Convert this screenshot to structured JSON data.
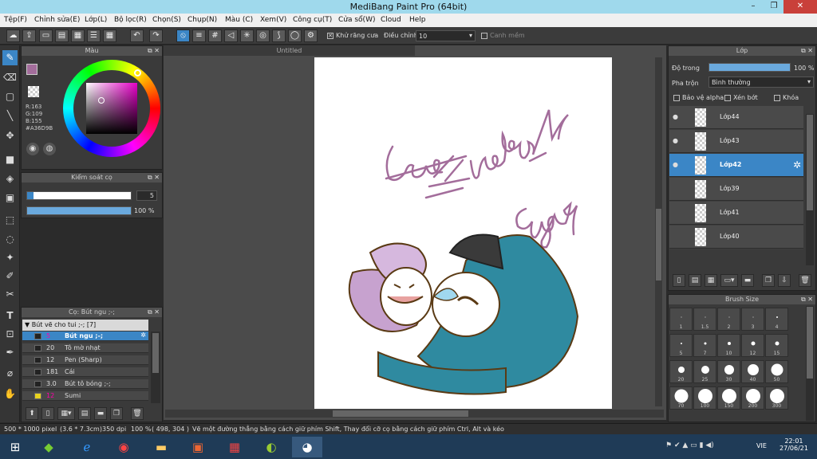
{
  "window": {
    "title": "MediBang Paint Pro (64bit)",
    "minimize": "–",
    "restore": "❐",
    "close": "✕"
  },
  "menu": [
    "Tệp(F)",
    "Chỉnh sửa(E)",
    "Lớp(L)",
    "Bộ lọc(R)",
    "Chọn(S)",
    "Chụp(N)",
    "Màu (C)",
    "Xem(V)",
    "Công cụ(T)",
    "Cửa sổ(W)",
    "Cloud",
    "Help"
  ],
  "toolbar": {
    "antialias_label": "Khử răng cưa",
    "correction_label": "Điều chỉnh",
    "correction_value": "10",
    "soft_label": "Canh mềm"
  },
  "color_panel": {
    "title": "Màu",
    "r": "R:163",
    "g": "G:109",
    "b": "B:155",
    "hex": "#A36D9B",
    "main_color": "#A36D9B"
  },
  "brush_control": {
    "title": "Kiểm soát cọ",
    "size_value": "5",
    "opacity_value": "100 %"
  },
  "brush_list": {
    "title": "Cọ: Bút ngu ;-;",
    "group": "Bút vẽ cho tui ;-; [7]",
    "items": [
      {
        "size": "5",
        "name": "Bút ngu ;-;",
        "swatch": "#222222"
      },
      {
        "size": "20",
        "name": "Tô mờ nhạt",
        "swatch": "#222222"
      },
      {
        "size": "12",
        "name": "Pen (Sharp)",
        "swatch": "#222222"
      },
      {
        "size": "181",
        "name": "Cái",
        "swatch": "#222222"
      },
      {
        "size": "3.0",
        "name": "Bút tô bóng ;-;",
        "swatch": "#222222"
      },
      {
        "size": "12",
        "name": "Sumi",
        "swatch": "#e8d21f"
      }
    ]
  },
  "document": {
    "tab": "Untitled"
  },
  "layers": {
    "title": "Lớp",
    "opacity_label": "Độ trong",
    "opacity_value": "100 %",
    "blend_label": "Pha trộn",
    "blend_value": "Bình thường",
    "protect_alpha": "Bảo vệ alpha",
    "clipping": "Xén bớt",
    "lock": "Khóa",
    "items": [
      {
        "name": "Lớp44"
      },
      {
        "name": "Lớp43"
      },
      {
        "name": "Lớp42"
      },
      {
        "name": "Lớp39"
      },
      {
        "name": "Lớp41"
      },
      {
        "name": "Lớp40"
      }
    ]
  },
  "brush_size": {
    "title": "Brush Size",
    "sizes": [
      "1",
      "1.5",
      "2",
      "3",
      "4",
      "5",
      "7",
      "10",
      "12",
      "15",
      "20",
      "25",
      "30",
      "40",
      "50",
      "70",
      "100",
      "150",
      "200",
      "300"
    ],
    "levels": [
      0.5,
      0.6,
      0.7,
      0.8,
      0.9,
      1.2,
      1.6,
      2.2,
      2.6,
      3.0,
      4.5,
      5.5,
      6.5,
      7.5,
      8.5,
      9.5,
      10,
      10,
      10,
      10
    ]
  },
  "status": {
    "size": "500 * 1000 pixel",
    "cm": "(3.6 * 7.3cm)",
    "dpi": "350 dpi",
    "zoom": "100 %",
    "coords": "( 498, 304 )",
    "hint": "Vẽ một đường thẳng bằng cách giữ phím Shift, Thay đổi cỡ cọ bằng cách giữ phím Ctrl, Alt và kéo"
  },
  "taskbar": {
    "lang": "VIE",
    "time": "22:01",
    "date": "27/06/21"
  }
}
